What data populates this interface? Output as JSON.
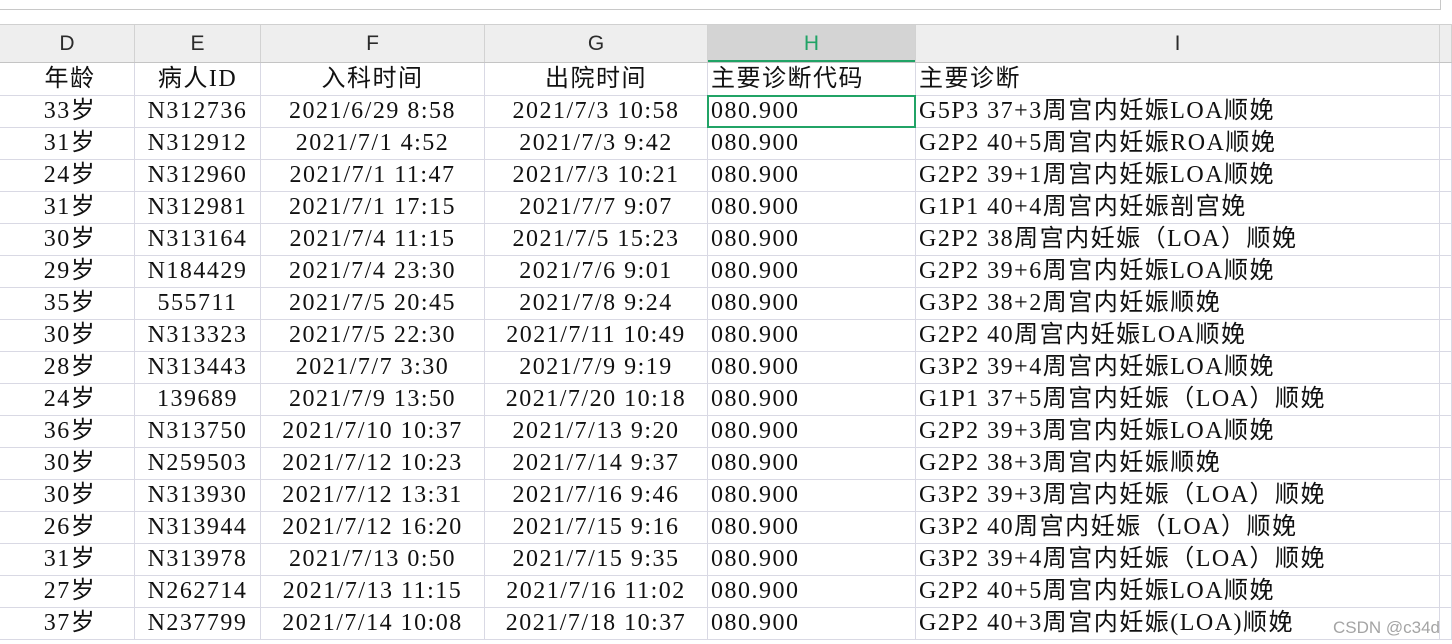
{
  "columns": [
    {
      "letter": "D",
      "label": "年龄"
    },
    {
      "letter": "E",
      "label": "病人ID"
    },
    {
      "letter": "F",
      "label": "入科时间"
    },
    {
      "letter": "G",
      "label": "出院时间"
    },
    {
      "letter": "H",
      "label": "主要诊断代码"
    },
    {
      "letter": "I",
      "label": "主要诊断"
    }
  ],
  "selected_cell": {
    "column": "H",
    "data_row": 0
  },
  "rows": [
    [
      "33岁",
      "N312736",
      "2021/6/29 8:58",
      "2021/7/3 10:58",
      "080.900",
      "G5P3 37+3周宫内妊娠LOA顺娩"
    ],
    [
      "31岁",
      "N312912",
      "2021/7/1 4:52",
      "2021/7/3 9:42",
      "080.900",
      "G2P2 40+5周宫内妊娠ROA顺娩"
    ],
    [
      "24岁",
      "N312960",
      "2021/7/1 11:47",
      "2021/7/3 10:21",
      "080.900",
      "G2P2 39+1周宫内妊娠LOA顺娩"
    ],
    [
      "31岁",
      "N312981",
      "2021/7/1 17:15",
      "2021/7/7 9:07",
      "080.900",
      "G1P1 40+4周宫内妊娠剖宫娩"
    ],
    [
      "30岁",
      "N313164",
      "2021/7/4 11:15",
      "2021/7/5 15:23",
      "080.900",
      "G2P2 38周宫内妊娠（LOA）顺娩"
    ],
    [
      "29岁",
      "N184429",
      "2021/7/4 23:30",
      "2021/7/6 9:01",
      "080.900",
      "G2P2 39+6周宫内妊娠LOA顺娩"
    ],
    [
      "35岁",
      "555711",
      "2021/7/5 20:45",
      "2021/7/8 9:24",
      "080.900",
      "G3P2 38+2周宫内妊娠顺娩"
    ],
    [
      "30岁",
      "N313323",
      "2021/7/5 22:30",
      "2021/7/11 10:49",
      "080.900",
      "G2P2 40周宫内妊娠LOA顺娩"
    ],
    [
      "28岁",
      "N313443",
      "2021/7/7 3:30",
      "2021/7/9 9:19",
      "080.900",
      "G3P2 39+4周宫内妊娠LOA顺娩"
    ],
    [
      "24岁",
      "139689",
      "2021/7/9 13:50",
      "2021/7/20 10:18",
      "080.900",
      "G1P1 37+5周宫内妊娠（LOA）顺娩"
    ],
    [
      "36岁",
      "N313750",
      "2021/7/10 10:37",
      "2021/7/13 9:20",
      "080.900",
      "G2P2 39+3周宫内妊娠LOA顺娩"
    ],
    [
      "30岁",
      "N259503",
      "2021/7/12 10:23",
      "2021/7/14 9:37",
      "080.900",
      "G2P2 38+3周宫内妊娠顺娩"
    ],
    [
      "30岁",
      "N313930",
      "2021/7/12 13:31",
      "2021/7/16 9:46",
      "080.900",
      "G3P2 39+3周宫内妊娠（LOA）顺娩"
    ],
    [
      "26岁",
      "N313944",
      "2021/7/12 16:20",
      "2021/7/15 9:16",
      "080.900",
      "G3P2 40周宫内妊娠（LOA）顺娩"
    ],
    [
      "31岁",
      "N313978",
      "2021/7/13 0:50",
      "2021/7/15 9:35",
      "080.900",
      "G3P2 39+4周宫内妊娠（LOA）顺娩"
    ],
    [
      "27岁",
      "N262714",
      "2021/7/13 11:15",
      "2021/7/16 11:02",
      "080.900",
      "G2P2 40+5周宫内妊娠LOA顺娩"
    ],
    [
      "37岁",
      "N237799",
      "2021/7/14 10:08",
      "2021/7/18 10:37",
      "080.900",
      "G2P2 40+3周宫内妊娠(LOA)顺娩"
    ]
  ],
  "watermark": "CSDN @c34d",
  "colors": {
    "accent": "#21a366",
    "header_bg": "#eeeeee",
    "header_selected_bg": "#d4d4d4",
    "gridline": "#d9d9e4"
  }
}
